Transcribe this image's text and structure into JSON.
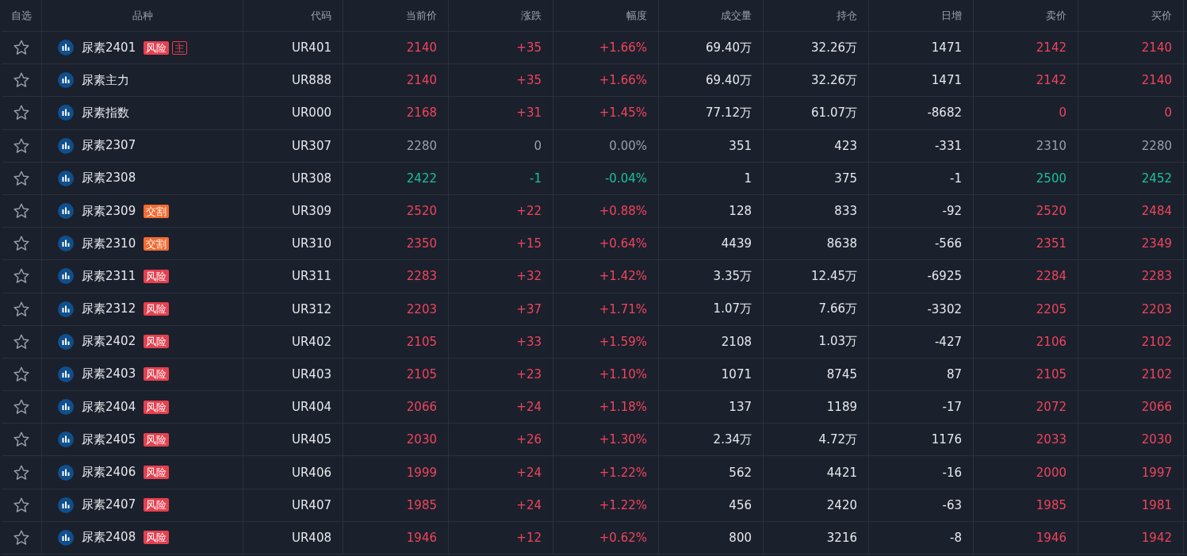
{
  "columns": [
    "自选",
    "品种",
    "代码",
    "当前价",
    "涨跌",
    "幅度",
    "成交量",
    "持仓",
    "日增",
    "卖价",
    "买价"
  ],
  "rows": [
    {
      "favorite": false,
      "name": "尿素2401",
      "tags": [
        {
          "label": "风险",
          "kind": "risk"
        },
        {
          "label": "主",
          "kind": "main"
        }
      ],
      "code": "UR401",
      "rising": true,
      "falling": false,
      "price": "2140",
      "change": "+35",
      "pct": "+1.66%",
      "volume": "69.40万",
      "oi": "32.26万",
      "daily": "1471",
      "ask": "2142",
      "bid": "2140"
    },
    {
      "favorite": false,
      "name": "尿素主力",
      "tags": [],
      "code": "UR888",
      "rising": true,
      "falling": false,
      "price": "2140",
      "change": "+35",
      "pct": "+1.66%",
      "volume": "69.40万",
      "oi": "32.26万",
      "daily": "1471",
      "ask": "2142",
      "bid": "2140"
    },
    {
      "favorite": false,
      "name": "尿素指数",
      "tags": [],
      "code": "UR000",
      "rising": true,
      "falling": false,
      "price": "2168",
      "change": "+31",
      "pct": "+1.45%",
      "volume": "77.12万",
      "oi": "61.07万",
      "daily": "-8682",
      "ask": "0",
      "bid": "0"
    },
    {
      "favorite": false,
      "name": "尿素2307",
      "tags": [],
      "code": "UR307",
      "rising": false,
      "falling": false,
      "price": "2280",
      "change": "0",
      "pct": "0.00%",
      "volume": "351",
      "oi": "423",
      "daily": "-331",
      "ask": "2310",
      "bid": "2280"
    },
    {
      "favorite": false,
      "name": "尿素2308",
      "tags": [],
      "code": "UR308",
      "rising": false,
      "falling": true,
      "price": "2422",
      "change": "-1",
      "pct": "-0.04%",
      "volume": "1",
      "oi": "375",
      "daily": "-1",
      "ask": "2500",
      "bid": "2452"
    },
    {
      "favorite": false,
      "name": "尿素2309",
      "tags": [
        {
          "label": "交割",
          "kind": "delivery"
        }
      ],
      "code": "UR309",
      "rising": true,
      "falling": false,
      "price": "2520",
      "change": "+22",
      "pct": "+0.88%",
      "volume": "128",
      "oi": "833",
      "daily": "-92",
      "ask": "2520",
      "bid": "2484"
    },
    {
      "favorite": false,
      "name": "尿素2310",
      "tags": [
        {
          "label": "交割",
          "kind": "delivery"
        }
      ],
      "code": "UR310",
      "rising": true,
      "falling": false,
      "price": "2350",
      "change": "+15",
      "pct": "+0.64%",
      "volume": "4439",
      "oi": "8638",
      "daily": "-566",
      "ask": "2351",
      "bid": "2349"
    },
    {
      "favorite": false,
      "name": "尿素2311",
      "tags": [
        {
          "label": "风险",
          "kind": "risk"
        }
      ],
      "code": "UR311",
      "rising": true,
      "falling": false,
      "price": "2283",
      "change": "+32",
      "pct": "+1.42%",
      "volume": "3.35万",
      "oi": "12.45万",
      "daily": "-6925",
      "ask": "2284",
      "bid": "2283"
    },
    {
      "favorite": false,
      "name": "尿素2312",
      "tags": [
        {
          "label": "风险",
          "kind": "risk"
        }
      ],
      "code": "UR312",
      "rising": true,
      "falling": false,
      "price": "2203",
      "change": "+37",
      "pct": "+1.71%",
      "volume": "1.07万",
      "oi": "7.66万",
      "daily": "-3302",
      "ask": "2205",
      "bid": "2203"
    },
    {
      "favorite": false,
      "name": "尿素2402",
      "tags": [
        {
          "label": "风险",
          "kind": "risk"
        }
      ],
      "code": "UR402",
      "rising": true,
      "falling": false,
      "price": "2105",
      "change": "+33",
      "pct": "+1.59%",
      "volume": "2108",
      "oi": "1.03万",
      "daily": "-427",
      "ask": "2106",
      "bid": "2102"
    },
    {
      "favorite": false,
      "name": "尿素2403",
      "tags": [
        {
          "label": "风险",
          "kind": "risk"
        }
      ],
      "code": "UR403",
      "rising": true,
      "falling": false,
      "price": "2105",
      "change": "+23",
      "pct": "+1.10%",
      "volume": "1071",
      "oi": "8745",
      "daily": "87",
      "ask": "2105",
      "bid": "2102"
    },
    {
      "favorite": false,
      "name": "尿素2404",
      "tags": [
        {
          "label": "风险",
          "kind": "risk"
        }
      ],
      "code": "UR404",
      "rising": true,
      "falling": false,
      "price": "2066",
      "change": "+24",
      "pct": "+1.18%",
      "volume": "137",
      "oi": "1189",
      "daily": "-17",
      "ask": "2072",
      "bid": "2066"
    },
    {
      "favorite": false,
      "name": "尿素2405",
      "tags": [
        {
          "label": "风险",
          "kind": "risk"
        }
      ],
      "code": "UR405",
      "rising": true,
      "falling": false,
      "price": "2030",
      "change": "+26",
      "pct": "+1.30%",
      "volume": "2.34万",
      "oi": "4.72万",
      "daily": "1176",
      "ask": "2033",
      "bid": "2030"
    },
    {
      "favorite": false,
      "name": "尿素2406",
      "tags": [
        {
          "label": "风险",
          "kind": "risk"
        }
      ],
      "code": "UR406",
      "rising": true,
      "falling": false,
      "price": "1999",
      "change": "+24",
      "pct": "+1.22%",
      "volume": "562",
      "oi": "4421",
      "daily": "-16",
      "ask": "2000",
      "bid": "1997"
    },
    {
      "favorite": false,
      "name": "尿素2407",
      "tags": [
        {
          "label": "风险",
          "kind": "risk"
        }
      ],
      "code": "UR407",
      "rising": true,
      "falling": false,
      "price": "1985",
      "change": "+24",
      "pct": "+1.22%",
      "volume": "456",
      "oi": "2420",
      "daily": "-63",
      "ask": "1985",
      "bid": "1981"
    },
    {
      "favorite": false,
      "name": "尿素2408",
      "tags": [
        {
          "label": "风险",
          "kind": "risk"
        }
      ],
      "code": "UR408",
      "rising": true,
      "falling": false,
      "price": "1946",
      "change": "+12",
      "pct": "+0.62%",
      "volume": "800",
      "oi": "3216",
      "daily": "-8",
      "ask": "1946",
      "bid": "1942"
    }
  ]
}
